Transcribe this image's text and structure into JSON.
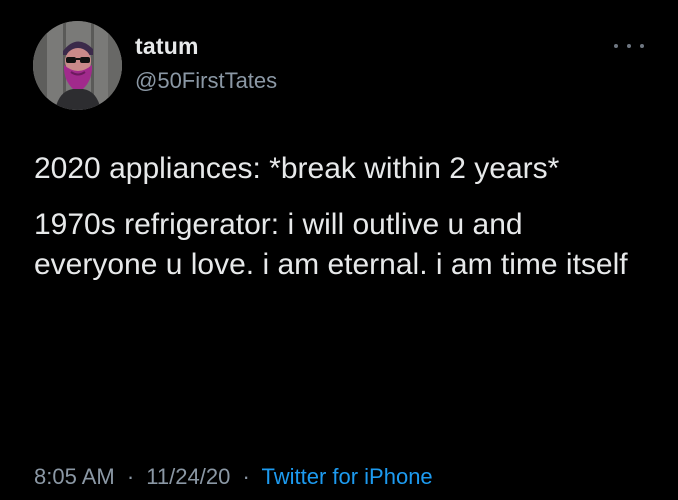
{
  "tweet": {
    "display_name": "tatum",
    "handle": "@50FirstTates",
    "paragraphs": [
      "2020 appliances: *break within 2 years*",
      "1970s refrigerator: i will outlive u and everyone u love. i am eternal. i am time itself"
    ],
    "time": "8:05 AM",
    "date": "11/24/20",
    "separator": "·",
    "source": "Twitter for iPhone"
  },
  "icons": {
    "more": "more-options-icon",
    "avatar": "bearded-man-avatar"
  },
  "colors": {
    "background": "#000000",
    "text": "#e7e9ea",
    "secondary_text": "#8b98a5",
    "link": "#1d9bf0"
  }
}
